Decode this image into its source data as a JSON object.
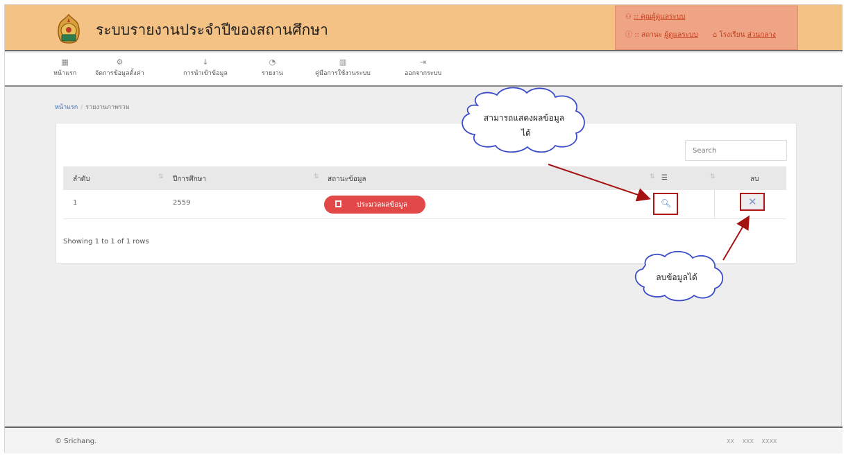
{
  "header": {
    "title": "ระบบรายงานประจำปีของสถานศึกษา",
    "user_line": ":: คุณผู้ดูแลระบบ",
    "status_prefix": ":: สถานะ",
    "status_value": "ผู้ดูแลระบบ",
    "school_prefix": "โรงเรียน",
    "school_value": "ส่วนกลาง"
  },
  "nav": {
    "items": [
      {
        "label": "หน้าแรก",
        "icon": "grid-icon"
      },
      {
        "label": "จัดการข้อมูลตั้งค่า",
        "icon": "gear-icon"
      },
      {
        "label": "การนำเข้าข้อมูล",
        "icon": "download-icon"
      },
      {
        "label": "รายงาน",
        "icon": "pie-chart-icon"
      },
      {
        "label": "คู่มือการใช้งานระบบ",
        "icon": "book-icon"
      },
      {
        "label": "ออกจากระบบ",
        "icon": "logout-icon"
      }
    ]
  },
  "breadcrumb": {
    "home": "หน้าแรก",
    "separator": "/",
    "current": "รายงานภาพรวม"
  },
  "table": {
    "search_placeholder": "Search",
    "columns": [
      "ลำดับ",
      "ปีการศึกษา",
      "สถานะข้อมูล",
      "ลบ"
    ],
    "rows": [
      {
        "index": "1",
        "year": "2559",
        "status_button": "ประมวลผลข้อมูล"
      }
    ],
    "showing": "Showing 1 to 1 of 1 rows"
  },
  "annotations": {
    "view_line1": "สามารถแสดงผลข้อมูล",
    "view_line2": "ได้",
    "delete_label": "ลบข้อมูลได้"
  },
  "footer": {
    "copyright": "© Srichang.",
    "right": "XX XXX XXXX"
  },
  "colors": {
    "header_bg": "#f5c286",
    "user_box_bg": "#f0a486",
    "process_button": "#e34848",
    "highlight_border": "#b01515",
    "arrow": "#a51212"
  }
}
